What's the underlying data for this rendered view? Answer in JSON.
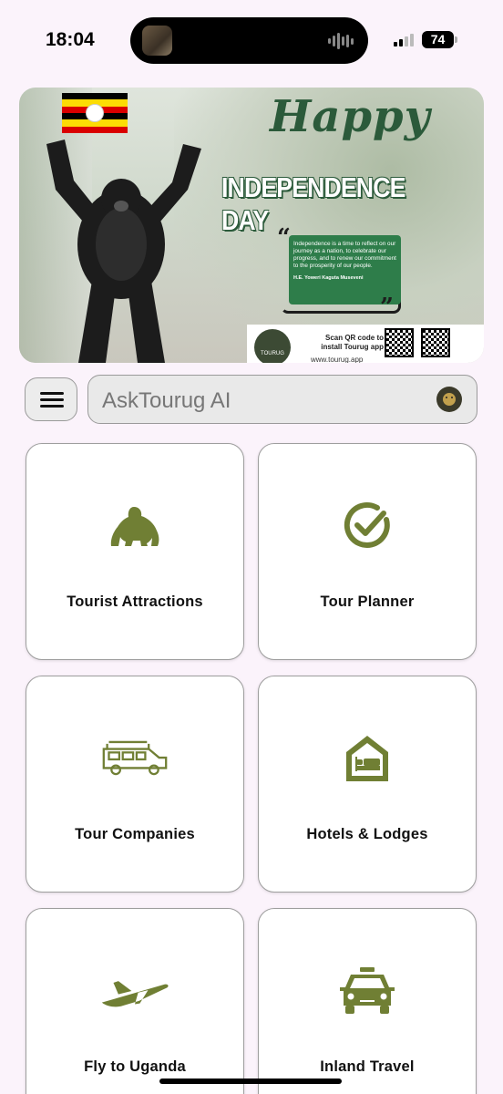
{
  "status_bar": {
    "time": "18:04",
    "battery": "74"
  },
  "banner": {
    "happy": "Happy",
    "title": "INDEPENDENCE DAY",
    "quote": "Independence is a time to reflect on our journey as a nation, to celebrate our progress, and to renew our commitment to the prosperity of our people.",
    "quote_author": "H.E. Yoweri Kaguta Museveni",
    "logo_text": "TOURUG",
    "scan_text": "Scan QR code to install Tourug app",
    "url": "www.tourug.app"
  },
  "search": {
    "placeholder": "AskTourug AI"
  },
  "tiles": [
    {
      "label": "Tourist Attractions",
      "icon": "gorilla-icon"
    },
    {
      "label": "Tour Planner",
      "icon": "check-circle-icon"
    },
    {
      "label": "Tour Companies",
      "icon": "safari-jeep-icon"
    },
    {
      "label": "Hotels & Lodges",
      "icon": "hotel-bed-icon"
    },
    {
      "label": "Fly to Uganda",
      "icon": "airplane-icon"
    },
    {
      "label": "Inland Travel",
      "icon": "taxi-icon"
    }
  ],
  "colors": {
    "accent": "#707f34",
    "background": "#fbf3fb",
    "banner_green": "#2e7d4a"
  }
}
